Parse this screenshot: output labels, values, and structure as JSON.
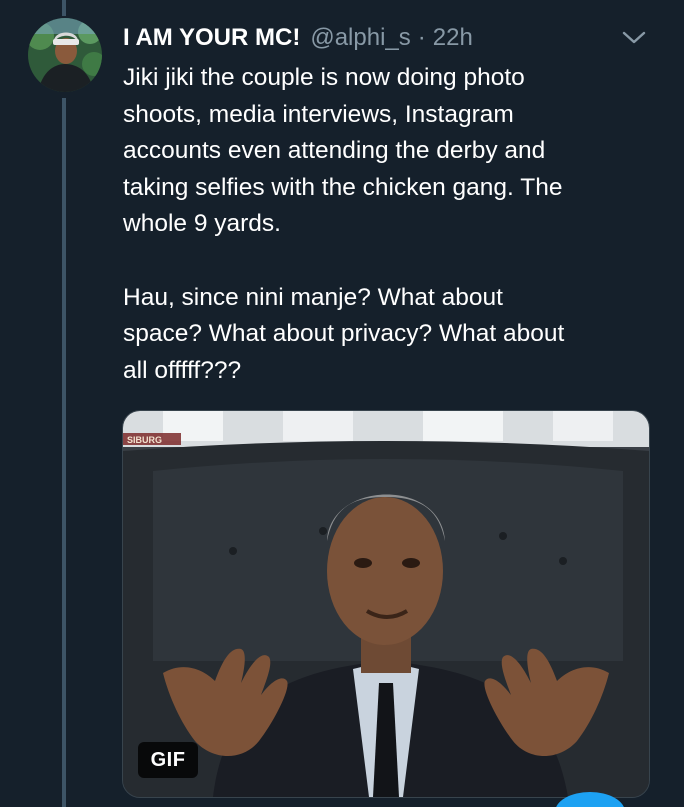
{
  "tweet": {
    "display_name": "I AM YOUR MC!",
    "handle": "@alphi_s",
    "separator": "·",
    "time": "22h",
    "paragraphs": [
      "Jiki jiki the couple is now doing photo\nshoots, media interviews, Instagram\naccounts even attending the derby and\ntaking selfies with the chicken gang. The\nwhole 9 yards.",
      "Hau, since nini manje? What about\nspace? What about privacy? What about\nall offfff???"
    ],
    "media": {
      "badge": "GIF",
      "watermark": "SIBURG"
    }
  },
  "icons": {
    "avatar": "user-avatar",
    "menu": "chevron-down-icon",
    "fab": "compose-fab-icon"
  },
  "colors": {
    "background": "#15202b",
    "secondary_text": "#8899a6",
    "thread_line": "#3d5466",
    "accent": "#1da1f2"
  }
}
